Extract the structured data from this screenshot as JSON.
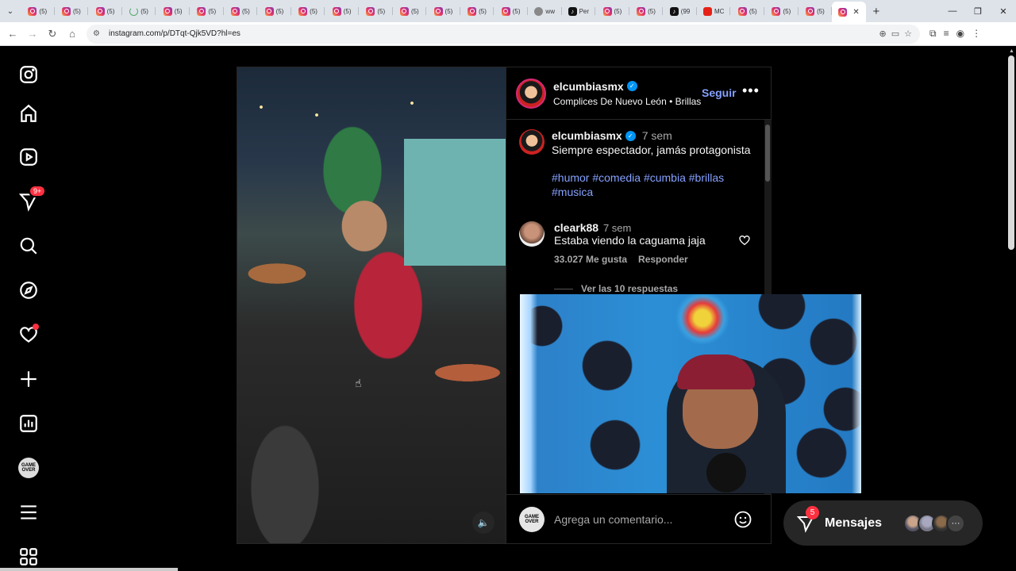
{
  "browser": {
    "tabs": [
      {
        "icon": "instagram-icon",
        "label": "(5)"
      },
      {
        "icon": "instagram-icon",
        "label": "(5)"
      },
      {
        "icon": "instagram-icon",
        "label": "(5)"
      },
      {
        "icon": "loading-icon",
        "label": "(5)"
      },
      {
        "icon": "instagram-icon",
        "label": "(5)"
      },
      {
        "icon": "instagram-icon",
        "label": "(5)"
      },
      {
        "icon": "instagram-icon",
        "label": "(5)"
      },
      {
        "icon": "instagram-icon",
        "label": "(5)"
      },
      {
        "icon": "instagram-icon",
        "label": "(5)"
      },
      {
        "icon": "instagram-icon",
        "label": "(5)"
      },
      {
        "icon": "instagram-icon",
        "label": "(5)"
      },
      {
        "icon": "instagram-icon",
        "label": "(5)"
      },
      {
        "icon": "instagram-icon",
        "label": "(5)"
      },
      {
        "icon": "instagram-icon",
        "label": "(5)"
      },
      {
        "icon": "instagram-icon",
        "label": "(5)"
      },
      {
        "icon": "web-icon",
        "label": "ww"
      },
      {
        "icon": "tiktok-icon",
        "label": "Per"
      },
      {
        "icon": "instagram-icon",
        "label": "(5)"
      },
      {
        "icon": "instagram-icon",
        "label": "(5)"
      },
      {
        "icon": "tiktok-icon",
        "label": "(99"
      },
      {
        "icon": "youtube-icon",
        "label": "MC"
      },
      {
        "icon": "instagram-icon",
        "label": "(5)"
      },
      {
        "icon": "instagram-icon",
        "label": "(5)"
      },
      {
        "icon": "instagram-icon",
        "label": "(5)"
      },
      {
        "icon": "instagram-icon",
        "label": "(5)"
      }
    ],
    "active_tab_close": "✕",
    "new_tab": "+",
    "url": "instagram.com/p/DTqt-Qjk5VD?hl=es"
  },
  "post": {
    "author": "elcumbiasmx",
    "location": "Complices De Nuevo León • Brillas",
    "follow_label": "Seguir",
    "more_label": "•••",
    "caption": {
      "author": "elcumbiasmx",
      "time": "7 sem",
      "text": "Siempre espectador, jamás protagonista",
      "hashtags": "#humor #comedia #cumbia #brillas #musica"
    },
    "comment": {
      "author": "cleark88",
      "time": "7 sem",
      "text": "Estaba viendo la caguama jaja",
      "likes": "33.027 Me gusta",
      "reply_label": "Responder",
      "view_replies": "Ver las 10 respuestas"
    },
    "add_comment_placeholder": "Agrega un comentario...",
    "commenter_avatar_text": "GAME OVER"
  },
  "nav": {
    "notifications_badge": "9+",
    "profile_avatar_text": "GAME OVER"
  },
  "messages": {
    "label": "Mensajes",
    "badge": "5",
    "more": "···"
  }
}
